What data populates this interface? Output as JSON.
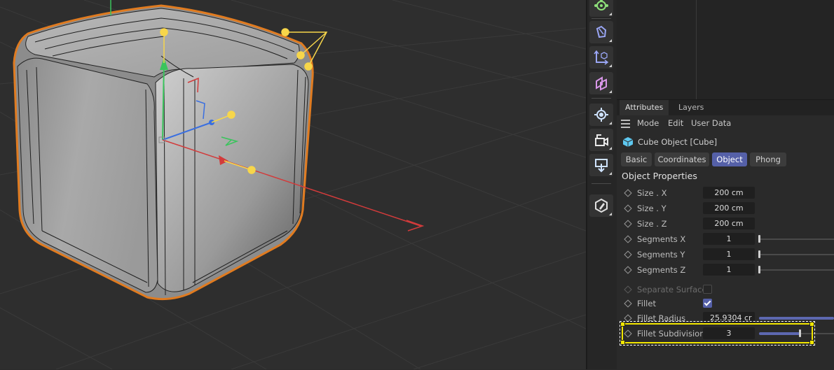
{
  "viewport": {
    "name": "3d-viewport"
  },
  "toolstrip": {
    "tools": [
      "polygon-pen-icon",
      "move-axis-icon",
      "snap-icon",
      "light-icon",
      "camera-icon",
      "deformer-icon",
      "sculpt-icon"
    ]
  },
  "attributes": {
    "tabs": [
      "Attributes",
      "Layers"
    ],
    "active_tab": "Attributes",
    "menu": [
      "Mode",
      "Edit",
      "User Data"
    ],
    "object_title": "Cube Object [Cube]",
    "mode_buttons": [
      "Basic",
      "Coordinates",
      "Object",
      "Phong"
    ],
    "active_mode": "Object",
    "section_title": "Object Properties",
    "properties": [
      {
        "label": "Size . X",
        "value": "200 cm"
      },
      {
        "label": "Size . Y",
        "value": "200 cm"
      },
      {
        "label": "Size . Z",
        "value": "200 cm"
      },
      {
        "label": "Segments X",
        "value": "1"
      },
      {
        "label": "Segments Y",
        "value": "1"
      },
      {
        "label": "Segments Z",
        "value": "1"
      },
      {
        "label": "Separate Surfaces",
        "checked": false
      },
      {
        "label": "Fillet",
        "checked": true
      },
      {
        "label": "Fillet Radius",
        "value": "25.9304 cr"
      },
      {
        "label": "Fillet Subdivision",
        "value": "3"
      }
    ]
  },
  "colors": {
    "accent": "#5560a8",
    "highlight": "#f2e600",
    "selection_outline": "#e07b20"
  }
}
